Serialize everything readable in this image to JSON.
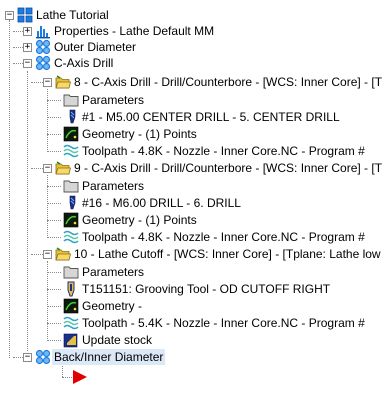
{
  "tree": {
    "root": {
      "label": "Lathe Tutorial",
      "expander": "−",
      "icon": "machine-group-icon"
    },
    "properties": {
      "label": "Properties - Lathe Default MM",
      "expander": "+",
      "icon": "properties-bar-icon"
    },
    "outer_diameter": {
      "label": "Outer Diameter",
      "expander": "+",
      "icon": "toolpath-group-icon"
    },
    "c_axis_drill": {
      "label": "C-Axis Drill",
      "expander": "−",
      "icon": "toolpath-group-icon"
    },
    "ops": [
      {
        "label": "8 - C-Axis Drill - Drill/Counterbore - [WCS: Inner Core] - [T",
        "expander": "−",
        "icon": "operation-folder-icon",
        "children": [
          {
            "label": "Parameters",
            "icon": "parameters-folder-icon"
          },
          {
            "label": "#1 - M5.00 CENTER DRILL -   5. CENTER DRILL",
            "icon": "drill-tool-icon"
          },
          {
            "label": "Geometry - (1) Points",
            "icon": "geometry-icon"
          },
          {
            "label": "Toolpath - 4.8K - Nozzle - Inner Core.NC - Program #",
            "icon": "toolpath-wave-icon"
          }
        ]
      },
      {
        "label": "9 - C-Axis Drill - Drill/Counterbore - [WCS: Inner Core] - [T",
        "expander": "−",
        "icon": "operation-folder-icon",
        "children": [
          {
            "label": "Parameters",
            "icon": "parameters-folder-icon"
          },
          {
            "label": "#16 - M6.00 DRILL -   6. DRILL",
            "icon": "drill-tool-icon"
          },
          {
            "label": "Geometry - (1) Points",
            "icon": "geometry-icon"
          },
          {
            "label": "Toolpath - 4.8K - Nozzle - Inner Core.NC - Program #",
            "icon": "toolpath-wave-icon"
          }
        ]
      },
      {
        "label": "10 - Lathe Cutoff - [WCS: Inner Core] - [Tplane: Lathe low",
        "expander": "−",
        "icon": "operation-folder-icon",
        "children": [
          {
            "label": "Parameters",
            "icon": "parameters-folder-icon"
          },
          {
            "label": "T151151: Grooving Tool - OD CUTOFF RIGHT",
            "icon": "grooving-tool-icon"
          },
          {
            "label": "Geometry -",
            "icon": "geometry-icon"
          },
          {
            "label": "Toolpath - 5.4K - Nozzle - Inner Core.NC - Program #",
            "icon": "toolpath-wave-icon"
          },
          {
            "label": "Update stock",
            "icon": "update-stock-icon"
          }
        ]
      }
    ],
    "back_inner_diameter": {
      "label": "Back/Inner Diameter",
      "expander": "−",
      "icon": "toolpath-group-icon"
    },
    "insert_arrow": {
      "icon": "insert-arrow-icon"
    }
  },
  "colors": {
    "selection": "#dbe8f6",
    "tree_lines": "#8a8a8a",
    "folder": "#e8c13c",
    "group_blue": "#1e7be0",
    "arrow_red": "#e00000"
  }
}
